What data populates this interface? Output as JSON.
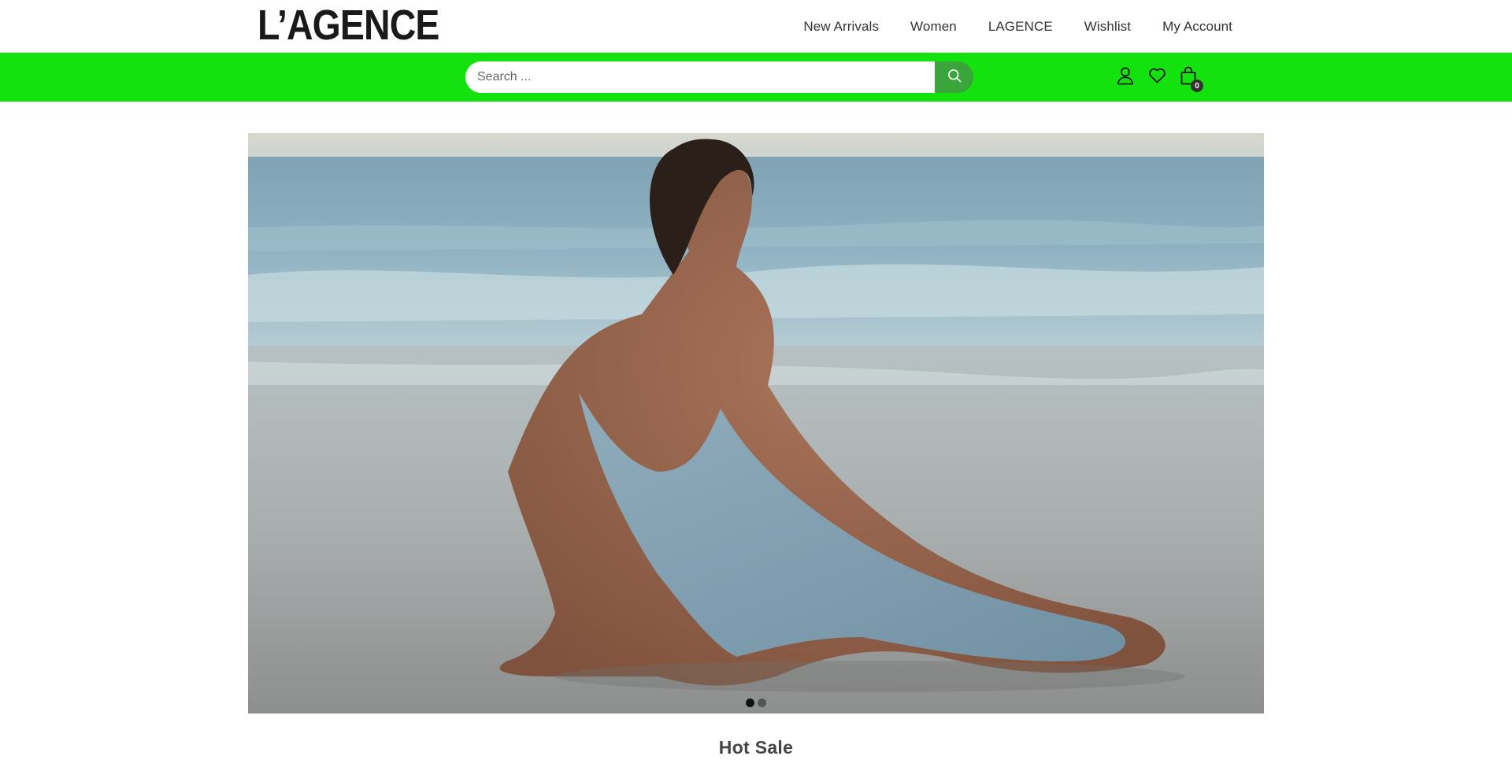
{
  "brand": {
    "logo_text": "L’AGENCE"
  },
  "nav": {
    "items": [
      {
        "label": "New Arrivals"
      },
      {
        "label": "Women"
      },
      {
        "label": "LAGENCE"
      },
      {
        "label": "Wishlist"
      },
      {
        "label": "My Account"
      }
    ]
  },
  "search": {
    "placeholder": "Search ...",
    "value": ""
  },
  "header_icons": {
    "account": "user-icon",
    "wishlist": "heart-icon",
    "cart": "bag-icon",
    "cart_count": "0"
  },
  "colors": {
    "search_bar_bg": "#13e20e",
    "search_button": "#3aa53a"
  },
  "hero": {
    "slides_total": 2,
    "active_slide": 1
  },
  "sections": {
    "hot_sale_title": "Hot Sale"
  }
}
